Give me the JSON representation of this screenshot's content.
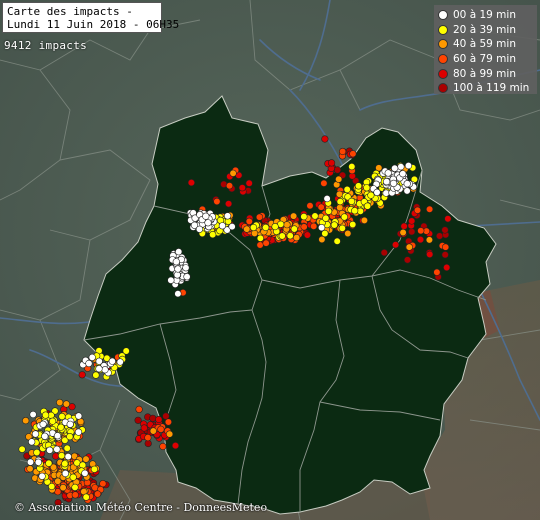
{
  "header": {
    "title_line1": "Carte des impacts -",
    "title_line2": "Lundi 11 Juin 2018 - 06H35"
  },
  "impact_count": "9412 impacts",
  "credit": "© Association Météo Centre - DonneesMeteo",
  "legend": {
    "items": [
      {
        "label": "00 à 19 min",
        "color": "#ffffff"
      },
      {
        "label": "20 à 39 min",
        "color": "#ffff00"
      },
      {
        "label": "40 à 59 min",
        "color": "#ff9900"
      },
      {
        "label": "60 à 79 min",
        "color": "#ff4400"
      },
      {
        "label": "80 à 99 min",
        "color": "#dd0000"
      },
      {
        "label": "100 à 119 min",
        "color": "#aa0000"
      }
    ]
  },
  "colors": {
    "region_fill": "#0b2a12",
    "outside_land": "#4e5d4d",
    "river": "#4f6d8f",
    "border": "#8d968d"
  }
}
